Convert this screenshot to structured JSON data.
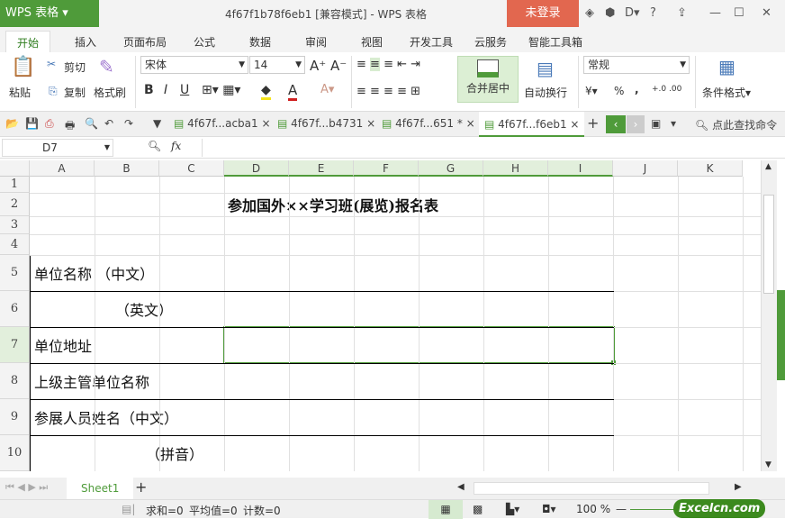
{
  "app": {
    "logo": "WPS 表格",
    "title": "4f67f1b78f6eb1 [兼容模式] - WPS 表格",
    "login": "未登录",
    "help": "?"
  },
  "menu_tabs": [
    "开始",
    "插入",
    "页面布局",
    "公式",
    "数据",
    "审阅",
    "视图",
    "开发工具",
    "云服务",
    "智能工具箱"
  ],
  "ribbon": {
    "paste": "粘贴",
    "cut": "剪切",
    "copy": "复制",
    "format_painter": "格式刷",
    "font": "宋体",
    "size": "14",
    "merge": "合并居中",
    "wrap": "自动换行",
    "number_format": "常规",
    "conditional": "条件格式",
    "percent": "%",
    "comma": ","
  },
  "doc_tabs": [
    "4f67f...acba1",
    "4f67f...b4731",
    "4f67f...651 *",
    "4f67f...f6eb1"
  ],
  "search_cmd": "点此查找命令",
  "formula_bar": {
    "name_box": "D7",
    "fx": "fx",
    "value": ""
  },
  "columns": [
    "A",
    "B",
    "C",
    "D",
    "E",
    "F",
    "G",
    "H",
    "I",
    "J",
    "K"
  ],
  "rows": [
    "1",
    "2",
    "3",
    "4",
    "5",
    "6",
    "7",
    "8",
    "9",
    "10"
  ],
  "cells": {
    "title": "参加国外××学习班(展览)报名表",
    "r5": "单位名称 （中文）",
    "r6": "（英文）",
    "r7": "单位地址",
    "r8": "上级主管单位名称",
    "r9": "参展人员姓名（中文）",
    "r10": "（拼音）"
  },
  "sheet_tabs": [
    "Sheet1"
  ],
  "status": {
    "sum": "求和=0",
    "avg": "平均值=0",
    "count": "计数=0",
    "zoom": "100 %",
    "watermark": "Excelcn.com"
  },
  "colors": {
    "accent": "#4f9b3a",
    "login": "#e2674f"
  }
}
